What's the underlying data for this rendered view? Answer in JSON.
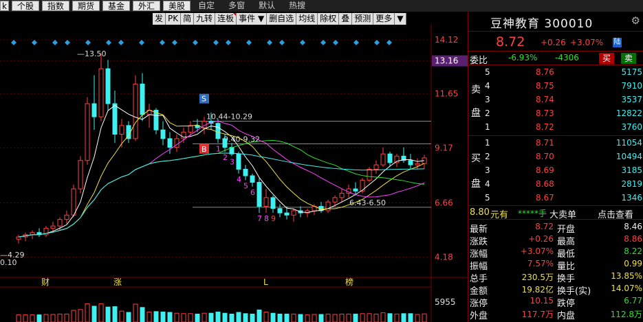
{
  "tabs": [
    "k",
    "个股",
    "指数",
    "期货",
    "基金",
    "外汇",
    "美股",
    "自定",
    "多窗",
    "默认",
    "热搜"
  ],
  "tabs_plain_from": 7,
  "toolbar": [
    {
      "label": "发",
      "corner": false
    },
    {
      "label": "PK",
      "corner": false
    },
    {
      "label": "简",
      "corner": false
    },
    {
      "label": "九转",
      "corner": false
    },
    {
      "label": "连板",
      "corner": true
    },
    {
      "label": "事件",
      "corner": false,
      "dropdown": "▼"
    },
    {
      "label": "删自选",
      "corner": false
    },
    {
      "label": "均线",
      "corner": false
    },
    {
      "label": "除权",
      "corner": false
    },
    {
      "label": "叠",
      "corner": false
    },
    {
      "label": "预测",
      "corner": false
    },
    {
      "label": "更多",
      "corner": false
    },
    {
      "label": "▼",
      "corner": false
    }
  ],
  "chart_icons": [
    "◎",
    "◐",
    "▶",
    "✂",
    "⟲",
    "⊕",
    "⊖"
  ],
  "price_axis": [
    "14.12",
    "13.16",
    "11.65",
    "9.17",
    "6.66",
    "4.18"
  ],
  "volume_axis": "5955",
  "annotations": {
    "high": "13.50",
    "zone1": "10.44-10.29",
    "zone2": "9.40-9.32",
    "zone3": "6.43-6.50",
    "left1": "4.29",
    "left2": "0.10",
    "s_marker": "S",
    "b_marker": "B",
    "nine_seq_up": [
      "1",
      "2",
      "3",
      "4",
      "5",
      "6",
      "7",
      "8",
      "9"
    ]
  },
  "event_marks": [
    "财",
    "涨",
    "L",
    "榜"
  ],
  "chart_data": {
    "type": "candlestick",
    "title": "",
    "ylim": [
      3.5,
      14.5
    ],
    "candles": [
      [
        5.0,
        5.2,
        4.8,
        5.1
      ],
      [
        5.1,
        5.3,
        4.9,
        5.2
      ],
      [
        5.2,
        5.4,
        5.0,
        5.3
      ],
      [
        5.3,
        5.5,
        5.1,
        5.2
      ],
      [
        5.2,
        5.6,
        5.1,
        5.5
      ],
      [
        5.5,
        5.8,
        5.3,
        5.6
      ],
      [
        5.6,
        6.0,
        5.4,
        5.9
      ],
      [
        5.9,
        6.3,
        5.7,
        6.1
      ],
      [
        6.1,
        7.5,
        6.0,
        7.3
      ],
      [
        7.3,
        8.8,
        7.1,
        8.6
      ],
      [
        8.6,
        11.5,
        8.4,
        11.2
      ],
      [
        11.2,
        12.5,
        10.0,
        10.6
      ],
      [
        10.6,
        13.5,
        10.4,
        12.8
      ],
      [
        12.8,
        13.2,
        10.9,
        11.2
      ],
      [
        11.2,
        11.8,
        9.4,
        9.8
      ],
      [
        9.8,
        10.5,
        9.2,
        10.2
      ],
      [
        10.2,
        10.4,
        9.4,
        9.6
      ],
      [
        9.6,
        12.5,
        9.5,
        12.1
      ],
      [
        12.1,
        12.6,
        10.4,
        10.7
      ],
      [
        10.7,
        11.2,
        10.1,
        10.9
      ],
      [
        10.9,
        11.0,
        9.8,
        10.0
      ],
      [
        10.0,
        10.4,
        9.3,
        9.6
      ],
      [
        9.6,
        9.9,
        8.9,
        9.2
      ],
      [
        9.2,
        9.8,
        9.0,
        9.6
      ],
      [
        9.6,
        10.1,
        9.4,
        9.9
      ],
      [
        9.9,
        10.4,
        9.7,
        10.2
      ],
      [
        10.2,
        10.5,
        9.9,
        10.1
      ],
      [
        10.1,
        10.6,
        9.8,
        10.4
      ],
      [
        10.4,
        10.8,
        10.0,
        10.3
      ],
      [
        10.3,
        10.5,
        9.4,
        9.6
      ],
      [
        9.6,
        9.8,
        9.0,
        9.2
      ],
      [
        9.2,
        9.4,
        8.8,
        8.9
      ],
      [
        8.9,
        9.0,
        8.0,
        8.2
      ],
      [
        8.2,
        8.4,
        7.7,
        7.9
      ],
      [
        7.9,
        8.0,
        7.4,
        7.6
      ],
      [
        7.6,
        7.8,
        6.2,
        6.5
      ],
      [
        6.5,
        7.3,
        6.2,
        6.9
      ],
      [
        6.9,
        7.0,
        6.2,
        6.4
      ],
      [
        6.4,
        6.6,
        6.0,
        6.2
      ],
      [
        6.2,
        6.5,
        5.9,
        6.1
      ],
      [
        6.1,
        6.4,
        5.8,
        6.3
      ],
      [
        6.3,
        6.5,
        6.0,
        6.2
      ],
      [
        6.2,
        6.4,
        6.0,
        6.3
      ],
      [
        6.3,
        6.6,
        6.1,
        6.5
      ],
      [
        6.5,
        6.7,
        6.2,
        6.3
      ],
      [
        6.3,
        6.8,
        6.2,
        6.7
      ],
      [
        6.7,
        7.0,
        6.5,
        6.9
      ],
      [
        6.9,
        7.3,
        6.7,
        7.1
      ],
      [
        7.1,
        7.5,
        6.9,
        7.3
      ],
      [
        7.3,
        7.6,
        7.0,
        7.2
      ],
      [
        7.2,
        7.8,
        7.1,
        7.7
      ],
      [
        7.7,
        8.3,
        7.6,
        8.2
      ],
      [
        8.2,
        8.6,
        8.0,
        8.4
      ],
      [
        8.4,
        9.2,
        8.3,
        8.9
      ],
      [
        8.9,
        9.0,
        8.3,
        8.5
      ],
      [
        8.5,
        8.9,
        8.3,
        8.8
      ],
      [
        8.8,
        9.2,
        8.5,
        8.6
      ],
      [
        8.6,
        8.9,
        8.2,
        8.4
      ],
      [
        8.4,
        8.7,
        8.2,
        8.46
      ],
      [
        8.46,
        8.86,
        8.22,
        8.72
      ]
    ],
    "ma_series": [
      {
        "color": "#ffffff",
        "period": 5
      },
      {
        "color": "#f0e040",
        "period": 10
      },
      {
        "color": "#ff40ff",
        "period": 20
      },
      {
        "color": "#2ee02e",
        "period": 30
      },
      {
        "color": "#3ff0f0",
        "period": 60
      }
    ]
  },
  "panel": {
    "title": "豆神教育 300010",
    "price": "8.72",
    "change": "+0.26",
    "pct": "+3.07%",
    "badge": "陆",
    "weibi_label": "委比",
    "weibi": "-6.93%",
    "weicha": "-4306",
    "sell_btn": "买",
    "buy_btn": "卖",
    "sell_label": "卖盘",
    "buy_label": "买盘",
    "asks": [
      {
        "lvl": "5",
        "price": "8.76",
        "vol": "5175"
      },
      {
        "lvl": "4",
        "price": "8.75",
        "vol": "7910"
      },
      {
        "lvl": "3",
        "price": "8.74",
        "vol": "3537"
      },
      {
        "lvl": "2",
        "price": "8.73",
        "vol": "12822"
      },
      {
        "lvl": "1",
        "price": "8.72",
        "vol": "3760"
      }
    ],
    "bids": [
      {
        "lvl": "1",
        "price": "8.71",
        "vol": "11054"
      },
      {
        "lvl": "2",
        "price": "8.70",
        "vol": "10494"
      },
      {
        "lvl": "3",
        "price": "8.69",
        "vol": "3185"
      },
      {
        "lvl": "4",
        "price": "8.68",
        "vol": "2819"
      },
      {
        "lvl": "5",
        "price": "8.67",
        "vol": "1346"
      }
    ],
    "bigorder": {
      "amount": "8.80",
      "unit": "元有",
      "stars": "*****手",
      "type": "大卖单",
      "link": "点击查看"
    },
    "stats": [
      {
        "l1": "最新",
        "v1": "8.72",
        "c1": "red",
        "l2": "开盘",
        "v2": "8.46",
        "c2": "white"
      },
      {
        "l1": "涨跌",
        "v1": "+0.26",
        "c1": "red",
        "l2": "最高",
        "v2": "8.86",
        "c2": "red"
      },
      {
        "l1": "涨幅",
        "v1": "+3.07%",
        "c1": "red",
        "l2": "最低",
        "v2": "8.22",
        "c2": "green"
      },
      {
        "l1": "振幅",
        "v1": "7.57%",
        "c1": "red",
        "l2": "量比",
        "v2": "0.99",
        "c2": "yel"
      },
      {
        "l1": "总手",
        "v1": "230.5万",
        "c1": "yel",
        "l2": "换手",
        "v2": "13.85%",
        "c2": "yel"
      },
      {
        "l1": "金额",
        "v1": "19.82亿",
        "c1": "yel",
        "l2": "换手(实)",
        "v2": "14.07%",
        "c2": "yel"
      },
      {
        "l1": "涨停",
        "v1": "10.15",
        "c1": "red",
        "l2": "跌停",
        "v2": "6.77",
        "c2": "green"
      },
      {
        "l1": "外盘",
        "v1": "117.7万",
        "c1": "red",
        "l2": "内盘",
        "v2": "112.8万",
        "c2": "green"
      }
    ]
  }
}
